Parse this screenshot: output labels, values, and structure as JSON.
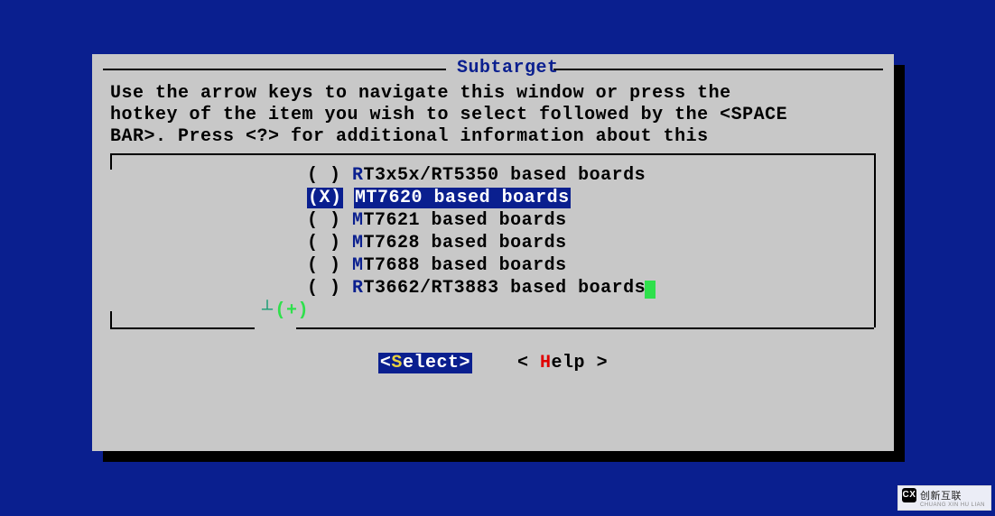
{
  "dialog": {
    "title": "Subtarget",
    "instructions_line1": "Use the arrow keys to navigate this window or press the",
    "instructions_line2": "hotkey of the item you wish to select followed by the <SPACE",
    "instructions_line3": "BAR>. Press <?> for additional information about this"
  },
  "options": [
    {
      "marker": "( )",
      "hotkey": "R",
      "rest": "T3x5x/RT5350 based boards",
      "selected": false
    },
    {
      "marker": "(X)",
      "hotkey": "M",
      "rest": "T7620 based boards",
      "selected": true
    },
    {
      "marker": "( )",
      "hotkey": "M",
      "rest": "T7621 based boards",
      "selected": false
    },
    {
      "marker": "( )",
      "hotkey": "M",
      "rest": "T7628 based boards",
      "selected": false
    },
    {
      "marker": "( )",
      "hotkey": "M",
      "rest": "T7688 based boards",
      "selected": false
    },
    {
      "marker": "( )",
      "hotkey": "R",
      "rest": "T3662/RT3883 based boards",
      "selected": false
    }
  ],
  "scroll_more": "(+)",
  "buttons": {
    "select": {
      "open": "<",
      "hot": "S",
      "rest": "elect",
      "close": ">",
      "active": true
    },
    "help": {
      "open": "<",
      "hot": "H",
      "rest": "elp",
      "close": ">",
      "active": false
    }
  },
  "watermark": {
    "logo": "CX",
    "text": "创新互联",
    "sub": "CHUANG XIN HU LIAN"
  }
}
